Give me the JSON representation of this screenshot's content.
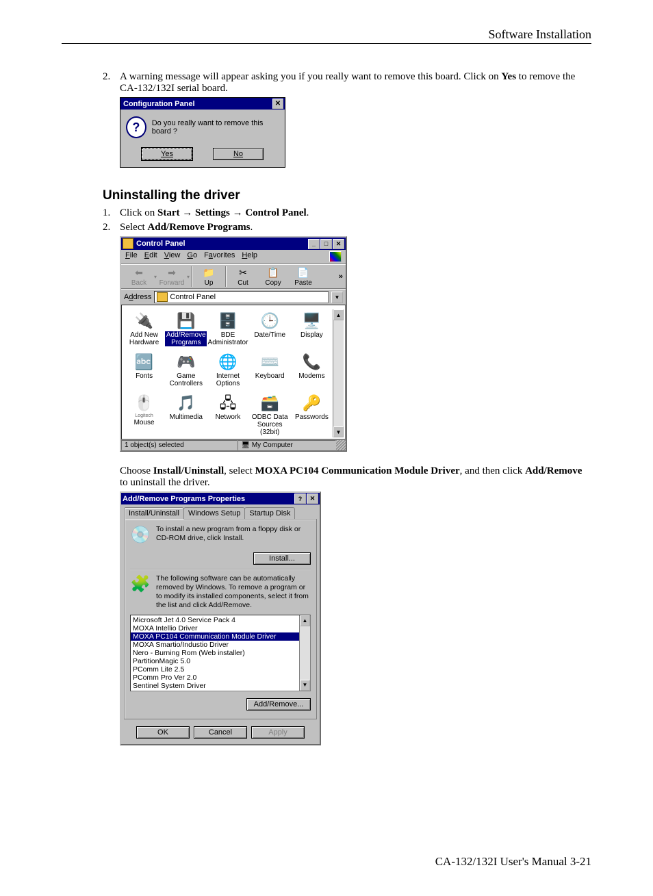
{
  "header": {
    "title": "Software Installation"
  },
  "step2": {
    "num": "2.",
    "text_a": "A warning message will appear asking you if you really want to remove this board. Click on ",
    "yes": "Yes",
    "text_b": " to remove the CA-132/132I serial board."
  },
  "dlg1": {
    "title": "Configuration Panel",
    "msg": "Do you really want to remove this board ?",
    "yes": "Yes",
    "no": "No"
  },
  "heading": "Uninstalling the driver",
  "step_u1": {
    "num": "1.",
    "a": "Click on ",
    "start": "Start",
    "arrow": " → ",
    "settings": "Settings",
    "cp": "Control Panel",
    "dot": "."
  },
  "step_u2": {
    "num": "2.",
    "a": "Select ",
    "b": "Add/Remove Programs",
    "dot": "."
  },
  "cp": {
    "title": "Control Panel",
    "menus": {
      "file": "File",
      "edit": "Edit",
      "view": "View",
      "go": "Go",
      "favorites": "Favorites",
      "help": "Help"
    },
    "tb": {
      "back": "Back",
      "forward": "Forward",
      "up": "Up",
      "cut": "Cut",
      "copy": "Copy",
      "paste": "Paste"
    },
    "address_label": "Address",
    "address_value": "Control Panel",
    "icons": [
      {
        "label": "Add New Hardware"
      },
      {
        "label": "Add/Remove Programs",
        "selected": true
      },
      {
        "label": "BDE Administrator"
      },
      {
        "label": "Date/Time"
      },
      {
        "label": "Display"
      },
      {
        "label": "Fonts"
      },
      {
        "label": "Game Controllers"
      },
      {
        "label": "Internet Options"
      },
      {
        "label": "Keyboard"
      },
      {
        "label": "Modems"
      },
      {
        "label": "Mouse",
        "prefix": "Logitech"
      },
      {
        "label": "Multimedia"
      },
      {
        "label": "Network"
      },
      {
        "label": "ODBC Data Sources (32bit)"
      },
      {
        "label": "Passwords"
      }
    ],
    "status_left": "1 object(s) selected",
    "status_right": "My Computer"
  },
  "para2": {
    "a": "Choose ",
    "b": "Install/Uninstall",
    "c": ", select ",
    "d": "MOXA PC104 Communication Module Driver",
    "e": ", and then click ",
    "f": "Add/Remove",
    "g": " to uninstall the driver."
  },
  "ar": {
    "title": "Add/Remove Programs Properties",
    "tabs": {
      "t1": "Install/Uninstall",
      "t2": "Windows Setup",
      "t3": "Startup Disk"
    },
    "info1": "To install a new program from a floppy disk or CD-ROM drive, click Install.",
    "install": "Install...",
    "info2": "The following software can be automatically removed by Windows. To remove a program or to modify its installed components, select it from the list and click Add/Remove.",
    "programs": [
      "Microsoft Jet 4.0 Service Pack 4",
      "MOXA Intellio Driver",
      "MOXA PC104 Communication Module Driver",
      "MOXA Smartio/Industio Driver",
      "Nero - Burning Rom (Web installer)",
      "PartitionMagic 5.0",
      "PComm Lite 2.5",
      "PComm Pro Ver 2.0",
      "Sentinel System Driver"
    ],
    "selected_index": 2,
    "addremove": "Add/Remove...",
    "ok": "OK",
    "cancel": "Cancel",
    "apply": "Apply"
  },
  "footer": "CA-132/132I  User's Manual  3-21"
}
